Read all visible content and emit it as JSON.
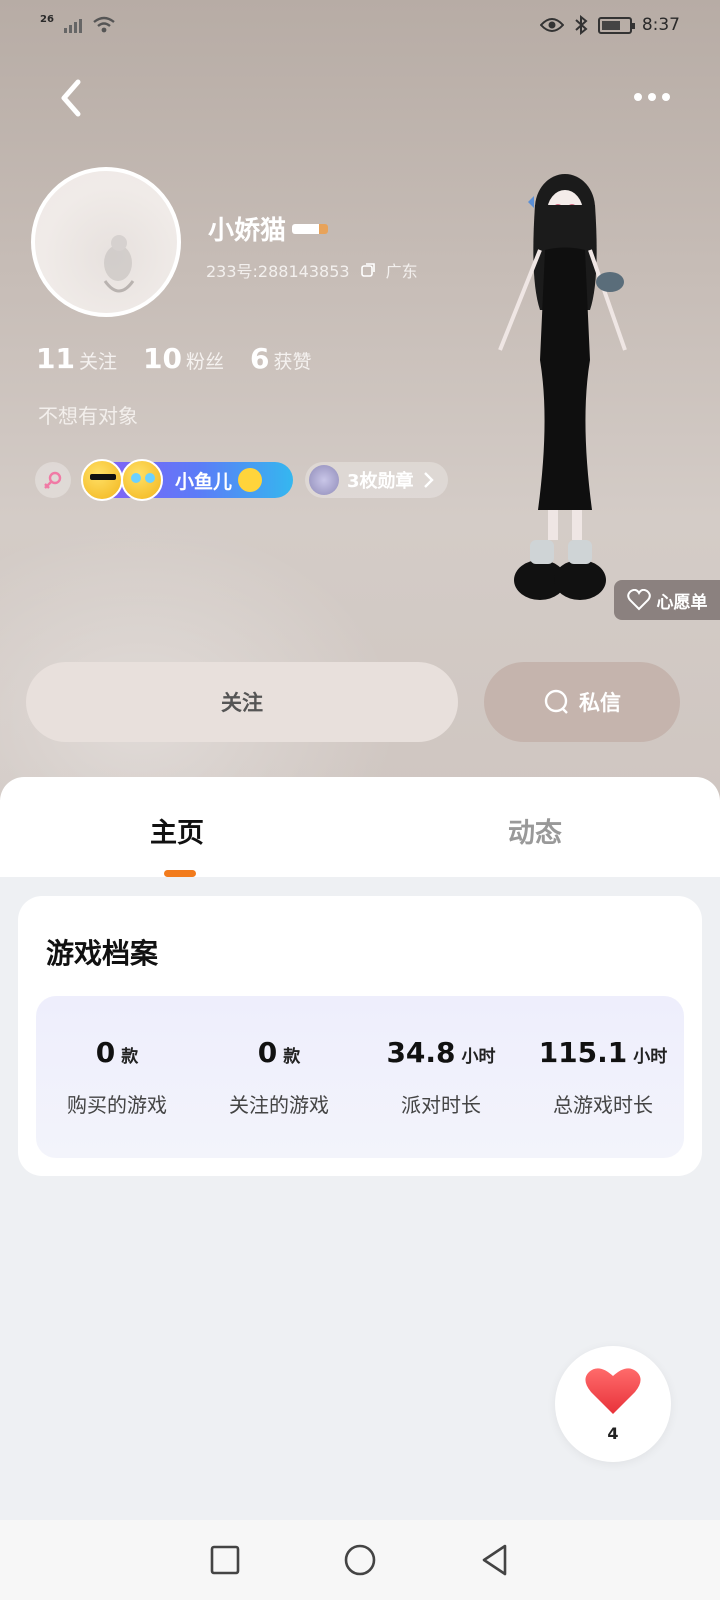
{
  "status_bar": {
    "signal_text": "26",
    "time": "8:37"
  },
  "profile": {
    "username": "小娇猫",
    "id_text": "233号:288143853",
    "location": "广东",
    "bio": "不想有对象",
    "stats": [
      {
        "num": "11",
        "label": "关注"
      },
      {
        "num": "10",
        "label": "粉丝"
      },
      {
        "num": "6",
        "label": "获赞"
      }
    ],
    "group_name": "小鱼儿",
    "medal_label": "3枚勋章"
  },
  "wishlist_label": "心愿单",
  "actions": {
    "follow_label": "关注",
    "message_label": "私信"
  },
  "tabs": [
    {
      "label": "主页"
    },
    {
      "label": "动态"
    }
  ],
  "game_archive": {
    "title": "游戏档案",
    "items": [
      {
        "value": "0",
        "unit": "款",
        "caption": "购买的游戏"
      },
      {
        "value": "0",
        "unit": "款",
        "caption": "关注的游戏"
      },
      {
        "value": "34.8",
        "unit": "小时",
        "caption": "派对时长"
      },
      {
        "value": "115.1",
        "unit": "小时",
        "caption": "总游戏时长"
      }
    ]
  },
  "like": {
    "count": "4"
  },
  "colors": {
    "accent": "#f27b1c",
    "tab_inactive": "#999999"
  }
}
